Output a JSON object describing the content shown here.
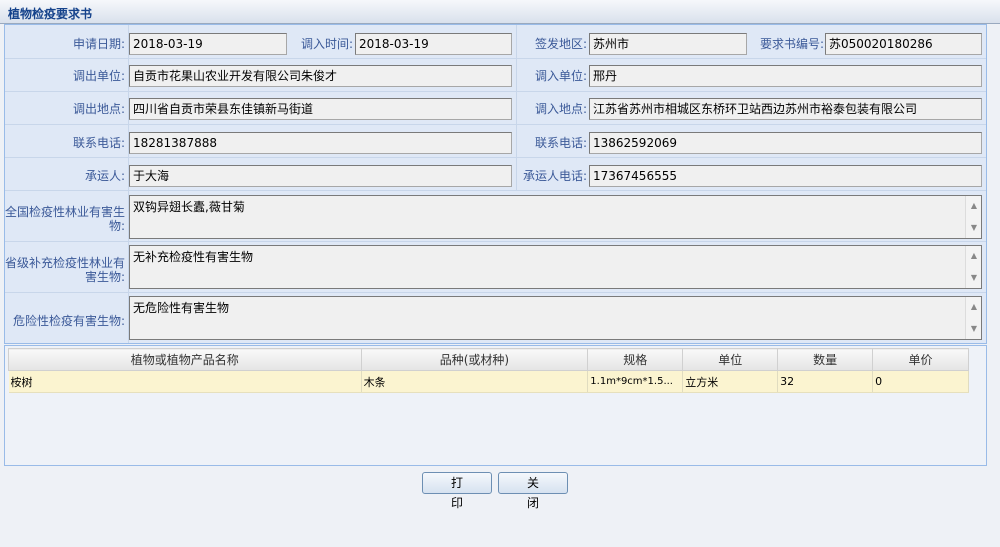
{
  "window": {
    "title": "植物检疫要求书"
  },
  "form": {
    "apply_date": {
      "label": "申请日期:",
      "value": "2018-03-19"
    },
    "import_time": {
      "label": "调入时间:",
      "value": "2018-03-19"
    },
    "issue_area": {
      "label": "签发地区:",
      "value": "苏州市"
    },
    "req_no": {
      "label": "要求书编号:",
      "value": "苏050020180286"
    },
    "out_unit": {
      "label": "调出单位:",
      "value": "自贡市花果山农业开发有限公司朱俊才"
    },
    "in_unit": {
      "label": "调入单位:",
      "value": "邢丹"
    },
    "out_place": {
      "label": "调出地点:",
      "value": "四川省自贡市荣县东佳镇新马街道"
    },
    "in_place": {
      "label": "调入地点:",
      "value": "江苏省苏州市相城区东桥环卫站西边苏州市裕泰包装有限公司"
    },
    "out_phone": {
      "label": "联系电话:",
      "value": "18281387888"
    },
    "in_phone": {
      "label": "联系电话:",
      "value": "13862592069"
    },
    "carrier": {
      "label": "承运人:",
      "value": "于大海"
    },
    "carrier_phone": {
      "label": "承运人电话:",
      "value": "17367456555"
    },
    "national_pests": {
      "label": "全国检疫性林业有害生物:",
      "value": "双钩异翅长蠹,薇甘菊"
    },
    "provincial_pests": {
      "label": "省级补充检疫性林业有害生物:",
      "value": "无补充检疫性有害生物"
    },
    "dangerous_pests": {
      "label": "危险性检疫有害生物:",
      "value": "无危险性有害生物"
    }
  },
  "grid": {
    "headers": [
      "植物或植物产品名称",
      "品种(或材种)",
      "规格",
      "单位",
      "数量",
      "单价"
    ],
    "rows": [
      [
        "桉树",
        "木条",
        "1.1m*9cm*1.5...",
        "立方米",
        "32",
        "0"
      ]
    ]
  },
  "buttons": {
    "print": "打印",
    "close": "关闭"
  }
}
